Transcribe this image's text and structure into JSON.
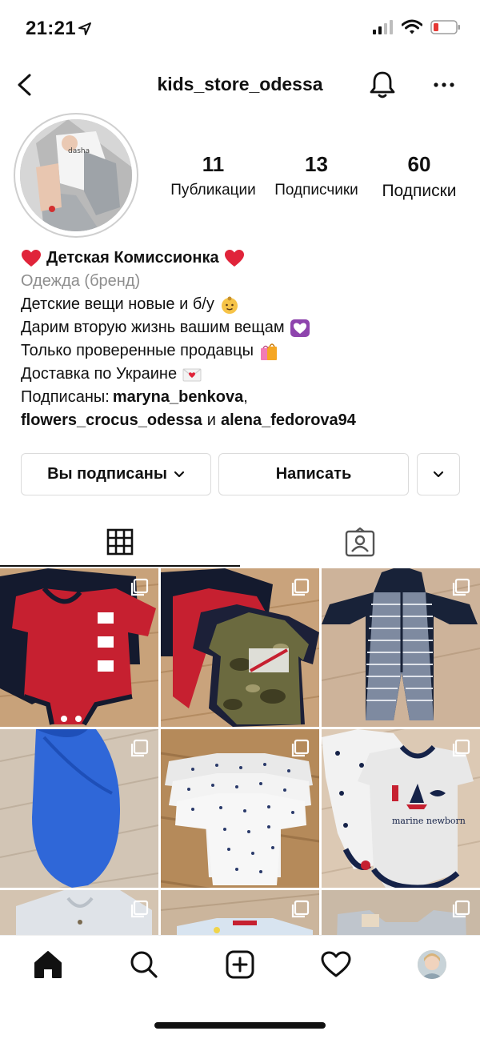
{
  "status_bar": {
    "time": "21:21",
    "battery_color": "#e53935"
  },
  "header": {
    "username": "kids_store_odessa"
  },
  "profile": {
    "stats": [
      {
        "value": "11",
        "label": "Публикации"
      },
      {
        "value": "13",
        "label": "Подписчики"
      },
      {
        "value": "60",
        "label": "Подписки"
      }
    ]
  },
  "bio": {
    "name": "Детская Комиссионка",
    "category": "Одежда (бренд)",
    "line1": "Детские вещи новые и б/у",
    "line2": "Дарим вторую жизнь вашим вещам",
    "line3": "Только проверенные продавцы",
    "line4": "Доставка по Украине",
    "followed_prefix": "Подписаны:",
    "followed_user1": "maryna_benkova",
    "followed_comma": ",",
    "followed_user2": "flowers_crocus_odessa",
    "followed_and": "и",
    "followed_user3": "alena_fedorova94"
  },
  "actions": {
    "subscribed_label": "Вы подписаны",
    "message_label": "Написать"
  },
  "tabs": [
    {
      "icon": "grid-icon",
      "active": true
    },
    {
      "icon": "tagged-person-icon",
      "active": false
    }
  ],
  "posts": [
    {
      "desc": "red navy bodysuits",
      "colors": [
        "#c8a27a",
        "#c62030",
        "#141a2e"
      ]
    },
    {
      "desc": "camo bodysuits set",
      "colors": [
        "#c9a37c",
        "#6b6a3f",
        "#141a2e"
      ]
    },
    {
      "desc": "striped navy hoodie romper",
      "colors": [
        "#cdb39a",
        "#7e8aa0",
        "#182238"
      ]
    },
    {
      "desc": "blue swaddle",
      "colors": [
        "#d2c5b5",
        "#2f67d8",
        "#1e4fb8"
      ]
    },
    {
      "desc": "white star bodysuits",
      "colors": [
        "#b58a5a",
        "#f1f1f1",
        "#2a3a6a"
      ]
    },
    {
      "desc": "marine newborn bodysuits",
      "colors": [
        "#dcc9b4",
        "#f2f2f2",
        "#152248"
      ]
    },
    {
      "desc": "grey sweater",
      "colors": [
        "#d4c4b1",
        "#dfe3e8"
      ]
    },
    {
      "desc": "light blue clothes",
      "colors": [
        "#cbb59c",
        "#d8e4f0"
      ]
    },
    {
      "desc": "grey vest",
      "colors": [
        "#c9b9a6",
        "#bfc5cc"
      ]
    }
  ],
  "nav": {
    "items": [
      "home-icon",
      "search-icon",
      "create-icon",
      "activity-icon",
      "profile-avatar"
    ]
  }
}
